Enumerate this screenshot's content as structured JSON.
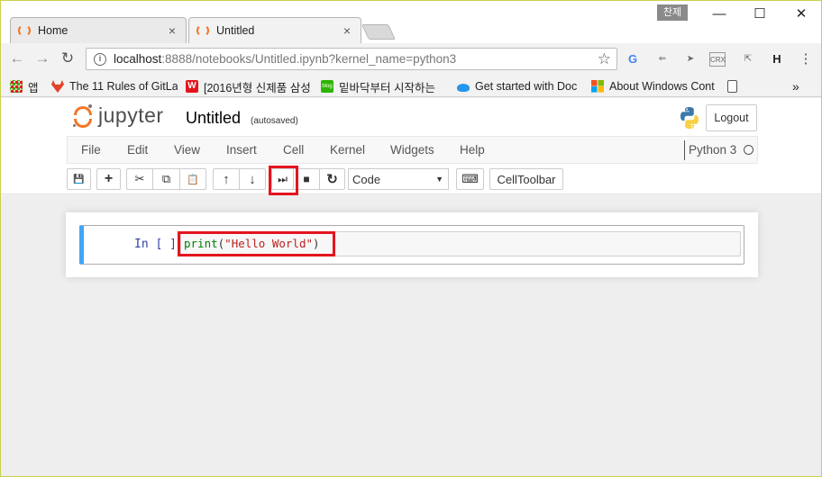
{
  "browser": {
    "tabs": [
      {
        "title": "Home",
        "close": "×",
        "active": false
      },
      {
        "title": "Untitled",
        "close": "×",
        "active": true
      }
    ],
    "ime_badge": "찬제",
    "window_controls": {
      "minimize": "—",
      "maximize": "☐",
      "close": "✕"
    },
    "nav": {
      "back": "←",
      "forward": "→",
      "reload": "↻"
    },
    "url_host": "localhost",
    "url_rest": ":8888/notebooks/Untitled.ipynb?kernel_name=python3",
    "star": "☆",
    "extensions": [
      "G",
      "⇐",
      "➤",
      "CRX",
      "⇱",
      "H",
      "⋮"
    ],
    "bookmarks": [
      {
        "label": "앱",
        "icon": "apps-icon"
      },
      {
        "label": "The 11 Rules of GitLa",
        "icon": "gitlab-icon",
        "color": "#e24329"
      },
      {
        "label": "[2016년형 신제품 삼성",
        "icon": "w-icon",
        "color": "#e4141e"
      },
      {
        "label": "밑바닥부터 시작하는",
        "icon": "blog-icon",
        "color": "#2db400"
      },
      {
        "label": "Get started with Doc",
        "icon": "docker-icon",
        "color": "#2496ed"
      },
      {
        "label": "About Windows Cont",
        "icon": "windows-icon"
      },
      {
        "label": "",
        "icon": "page-icon"
      }
    ],
    "bookmarks_more": "»"
  },
  "jupyter": {
    "logo_text": "jupyter",
    "notebook_name": "Untitled",
    "autosave": "(autosaved)",
    "logout": "Logout",
    "menu": [
      "File",
      "Edit",
      "View",
      "Insert",
      "Cell",
      "Kernel",
      "Widgets",
      "Help"
    ],
    "kernel": "Python 3",
    "toolbar": {
      "save": "💾",
      "insert": "+",
      "cut": "✂",
      "copy": "⧉",
      "paste": "📋",
      "move_up": "↑",
      "move_down": "↓",
      "run": "⏭",
      "interrupt": "■",
      "restart": "↻",
      "cell_type": "Code",
      "cell_type_caret": "▼",
      "command_palette": "⌨",
      "celltoolbar": "CellToolbar"
    },
    "cell": {
      "prompt": "In [ ]:",
      "code_builtin": "print",
      "code_open": "(",
      "code_string": "\"Hello World\"",
      "code_close": ")"
    },
    "colors": {
      "accent": "#f37626",
      "selected_cell": "#42a5f5",
      "highlight": "#e4141e"
    }
  }
}
